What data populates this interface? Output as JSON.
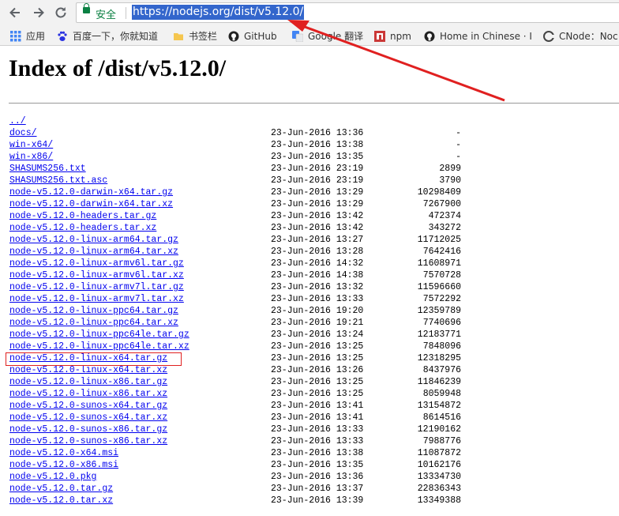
{
  "toolbar": {
    "back_icon": "back-arrow-icon",
    "forward_icon": "forward-arrow-icon",
    "reload_icon": "reload-icon",
    "secure_label": "安全",
    "url": "https://nodejs.org/dist/v5.12.0/"
  },
  "bookmarks": [
    {
      "label": "应用",
      "icon": "apps-grid-icon",
      "color": "#4285f4"
    },
    {
      "label": "百度一下，你就知道",
      "icon": "baidu-paw-icon",
      "color": "#2932e1"
    },
    {
      "label": "书签栏",
      "icon": "folder-icon",
      "color": "#f5c64f"
    },
    {
      "label": "GitHub",
      "icon": "github-icon",
      "color": "#222222"
    },
    {
      "label": "Google 翻译",
      "icon": "google-translate-icon",
      "color": "#4285f4"
    },
    {
      "label": "npm",
      "icon": "npm-icon",
      "color": "#cb3837"
    },
    {
      "label": "Home in Chinese · I",
      "icon": "github-icon",
      "color": "#222222"
    },
    {
      "label": "CNode：Noc",
      "icon": "cnode-icon",
      "color": "#444444"
    }
  ],
  "page": {
    "title": "Index of /dist/v5.12.0/",
    "entries": [
      {
        "name": "../",
        "date": "",
        "size": ""
      },
      {
        "name": "docs/",
        "date": "23-Jun-2016 13:36",
        "size": "-"
      },
      {
        "name": "win-x64/",
        "date": "23-Jun-2016 13:38",
        "size": "-"
      },
      {
        "name": "win-x86/",
        "date": "23-Jun-2016 13:35",
        "size": "-"
      },
      {
        "name": "SHASUMS256.txt",
        "date": "23-Jun-2016 23:19",
        "size": "2899"
      },
      {
        "name": "SHASUMS256.txt.asc",
        "date": "23-Jun-2016 23:19",
        "size": "3790"
      },
      {
        "name": "node-v5.12.0-darwin-x64.tar.gz",
        "date": "23-Jun-2016 13:29",
        "size": "10298409"
      },
      {
        "name": "node-v5.12.0-darwin-x64.tar.xz",
        "date": "23-Jun-2016 13:29",
        "size": "7267900"
      },
      {
        "name": "node-v5.12.0-headers.tar.gz",
        "date": "23-Jun-2016 13:42",
        "size": "472374"
      },
      {
        "name": "node-v5.12.0-headers.tar.xz",
        "date": "23-Jun-2016 13:42",
        "size": "343272"
      },
      {
        "name": "node-v5.12.0-linux-arm64.tar.gz",
        "date": "23-Jun-2016 13:27",
        "size": "11712025"
      },
      {
        "name": "node-v5.12.0-linux-arm64.tar.xz",
        "date": "23-Jun-2016 13:28",
        "size": "7642416"
      },
      {
        "name": "node-v5.12.0-linux-armv6l.tar.gz",
        "date": "23-Jun-2016 14:32",
        "size": "11608971"
      },
      {
        "name": "node-v5.12.0-linux-armv6l.tar.xz",
        "date": "23-Jun-2016 14:38",
        "size": "7570728"
      },
      {
        "name": "node-v5.12.0-linux-armv7l.tar.gz",
        "date": "23-Jun-2016 13:32",
        "size": "11596660"
      },
      {
        "name": "node-v5.12.0-linux-armv7l.tar.xz",
        "date": "23-Jun-2016 13:33",
        "size": "7572292"
      },
      {
        "name": "node-v5.12.0-linux-ppc64.tar.gz",
        "date": "23-Jun-2016 19:20",
        "size": "12359789"
      },
      {
        "name": "node-v5.12.0-linux-ppc64.tar.xz",
        "date": "23-Jun-2016 19:21",
        "size": "7740696"
      },
      {
        "name": "node-v5.12.0-linux-ppc64le.tar.gz",
        "date": "23-Jun-2016 13:24",
        "size": "12183771"
      },
      {
        "name": "node-v5.12.0-linux-ppc64le.tar.xz",
        "date": "23-Jun-2016 13:25",
        "size": "7848096"
      },
      {
        "name": "node-v5.12.0-linux-x64.tar.gz",
        "date": "23-Jun-2016 13:25",
        "size": "12318295"
      },
      {
        "name": "node-v5.12.0-linux-x64.tar.xz",
        "date": "23-Jun-2016 13:26",
        "size": "8437976"
      },
      {
        "name": "node-v5.12.0-linux-x86.tar.gz",
        "date": "23-Jun-2016 13:25",
        "size": "11846239"
      },
      {
        "name": "node-v5.12.0-linux-x86.tar.xz",
        "date": "23-Jun-2016 13:25",
        "size": "8059948"
      },
      {
        "name": "node-v5.12.0-sunos-x64.tar.gz",
        "date": "23-Jun-2016 13:41",
        "size": "13154872"
      },
      {
        "name": "node-v5.12.0-sunos-x64.tar.xz",
        "date": "23-Jun-2016 13:41",
        "size": "8614516"
      },
      {
        "name": "node-v5.12.0-sunos-x86.tar.gz",
        "date": "23-Jun-2016 13:33",
        "size": "12190162"
      },
      {
        "name": "node-v5.12.0-sunos-x86.tar.xz",
        "date": "23-Jun-2016 13:33",
        "size": "7988776"
      },
      {
        "name": "node-v5.12.0-x64.msi",
        "date": "23-Jun-2016 13:38",
        "size": "11087872"
      },
      {
        "name": "node-v5.12.0-x86.msi",
        "date": "23-Jun-2016 13:35",
        "size": "10162176"
      },
      {
        "name": "node-v5.12.0.pkg",
        "date": "23-Jun-2016 13:36",
        "size": "13334730"
      },
      {
        "name": "node-v5.12.0.tar.gz",
        "date": "23-Jun-2016 13:37",
        "size": "22836343"
      },
      {
        "name": "node-v5.12.0.tar.xz",
        "date": "23-Jun-2016 13:39",
        "size": "13349388"
      }
    ]
  },
  "annotations": {
    "highlight_color": "#e02020"
  }
}
